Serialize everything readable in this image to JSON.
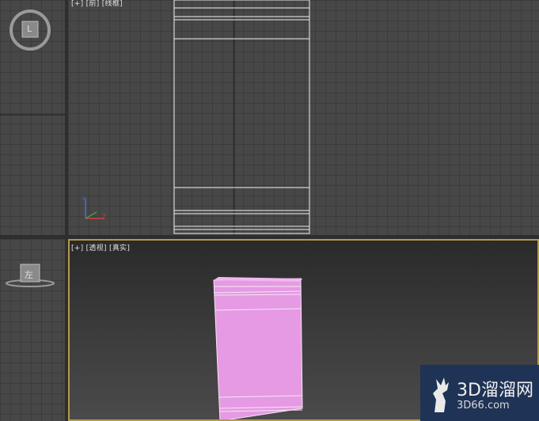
{
  "viewports": {
    "top_right": {
      "label": "[+] [前] [线框]"
    },
    "perspective": {
      "label": "[+] [透视] [真实]"
    }
  },
  "viewcube": {
    "top_face": "L",
    "bottom_face": "左"
  },
  "axis_tripod": {
    "icon": "xyz-axis-icon"
  },
  "model": {
    "color": "#e59ae3"
  },
  "watermark": {
    "main": "3D溜溜网",
    "sub": "3D66.com",
    "bg": "#1f3356"
  }
}
